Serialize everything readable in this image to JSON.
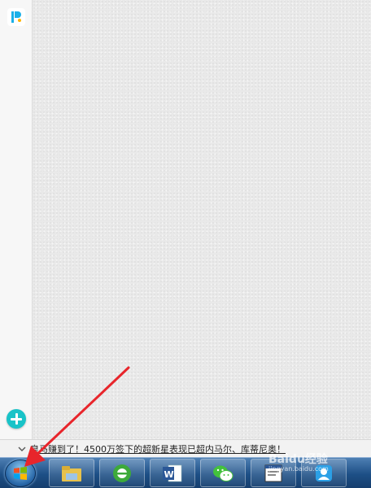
{
  "ticker": {
    "headline": "皇马赚到了！4500万签下的超新星表现已超内马尔、库蒂尼奥！"
  },
  "watermark": {
    "brand": "Baidu经验",
    "url": "jingyan.baidu.com"
  },
  "colors": {
    "accent_teal": "#19c3c8",
    "arrow_red": "#e8252b",
    "taskbar_blue": "#1d4f86"
  },
  "taskbar": {
    "items": [
      {
        "icon": "file-explorer-icon"
      },
      {
        "icon": "browser-icon"
      },
      {
        "icon": "word-icon"
      },
      {
        "icon": "wechat-icon"
      },
      {
        "icon": "app-window-icon"
      },
      {
        "icon": "contacts-icon"
      }
    ]
  }
}
